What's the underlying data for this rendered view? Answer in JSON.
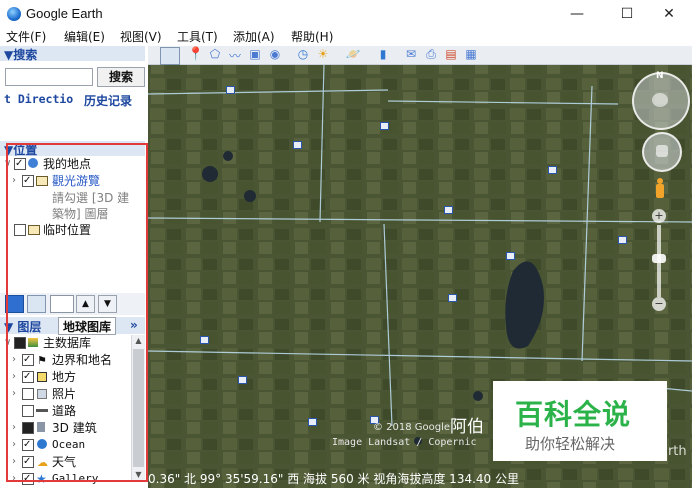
{
  "window": {
    "title": "Google Earth",
    "minimize": "—",
    "maximize": "☐",
    "close": "✕"
  },
  "menu": [
    {
      "label": "文件(F)"
    },
    {
      "label": "编辑(E)"
    },
    {
      "label": "视图(V)"
    },
    {
      "label": "工具(T)"
    },
    {
      "label": "添加(A)"
    },
    {
      "label": "帮助(H)"
    }
  ],
  "search": {
    "header": "▼搜索",
    "button": "搜索",
    "tabs_left": "t Directio",
    "tabs_right": "历史记录"
  },
  "places": {
    "header": "▼位置",
    "items": [
      {
        "label": "我的地点"
      },
      {
        "label": "觀光游覽"
      },
      {
        "label": "請勾選 [3D 建"
      },
      {
        "label": "築物] 圖層"
      },
      {
        "label": "临时位置"
      }
    ]
  },
  "layers": {
    "tab_layers": "图层",
    "tab_gallery": "地球图库",
    "more": "»",
    "primary": "主数据库",
    "items": [
      {
        "label": "边界和地名"
      },
      {
        "label": "地方"
      },
      {
        "label": "照片"
      },
      {
        "label": "道路"
      },
      {
        "label": "3D 建筑"
      },
      {
        "label": "Ocean"
      },
      {
        "label": "天气"
      },
      {
        "label": "Gallery"
      }
    ]
  },
  "map": {
    "copyright": "© 2018 Google",
    "imagery": "Image Landsat / Copernic",
    "place_label": "阿伯",
    "earth_word": "arth",
    "north_label": "N"
  },
  "status": {
    "text": "0.36\" 北  99° 35'59.16\" 西 海拔   560 米  视角海拔高度 134.40 公里"
  },
  "watermark": {
    "title": "百科全说",
    "subtitle": "助你轻松解决"
  }
}
